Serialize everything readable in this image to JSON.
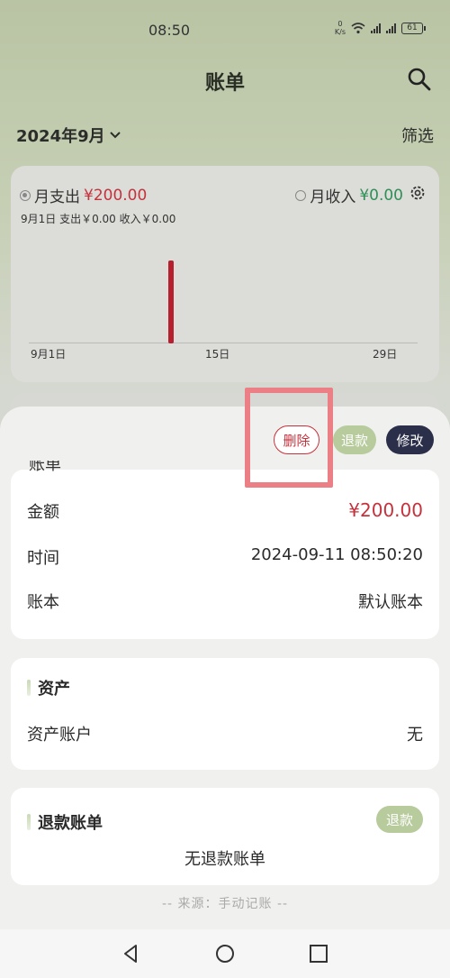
{
  "status_bar": {
    "time": "08:50",
    "net_speed_value": "0",
    "net_speed_unit": "K/s",
    "battery": "61"
  },
  "header": {
    "title": "账单",
    "month": "2024年9月",
    "filter_label": "筛选"
  },
  "summary": {
    "expense_label": "月支出",
    "expense_value": "¥200.00",
    "income_label": "月收入",
    "income_value": "¥0.00",
    "day_summary": "9月1日  支出￥0.00  收入￥0.00",
    "selected": "expense"
  },
  "chart_data": {
    "type": "bar",
    "x_ticks": [
      "9月1日",
      "15日",
      "29日"
    ],
    "x": [
      "2024-09-11"
    ],
    "values": [
      200
    ],
    "bar_color": "#b51f2e"
  },
  "sheet": {
    "actions": {
      "delete_label": "删除",
      "refund_label": "退款",
      "edit_label": "修改"
    },
    "detail": {
      "section_title": "账单",
      "amount_label": "金额",
      "amount_value": "¥200.00",
      "time_label": "时间",
      "time_value": "2024-09-11 08:50:20",
      "book_label": "账本",
      "book_value": "默认账本"
    },
    "asset": {
      "title": "资产",
      "account_label": "资产账户",
      "account_value": "无"
    },
    "refund": {
      "title": "退款账单",
      "tag_label": "退款",
      "empty_text": "无退款账单"
    },
    "source_text": "-- 来源：手动记账 --"
  },
  "colors": {
    "accent_red": "#c5323c",
    "accent_green": "#b7cb9d",
    "dark_button": "#2c2f4a",
    "highlight": "#ec7e86"
  },
  "icons": [
    "search-icon",
    "chevron-down-icon",
    "gear-icon",
    "back-icon",
    "home-icon",
    "recent-apps-icon"
  ]
}
